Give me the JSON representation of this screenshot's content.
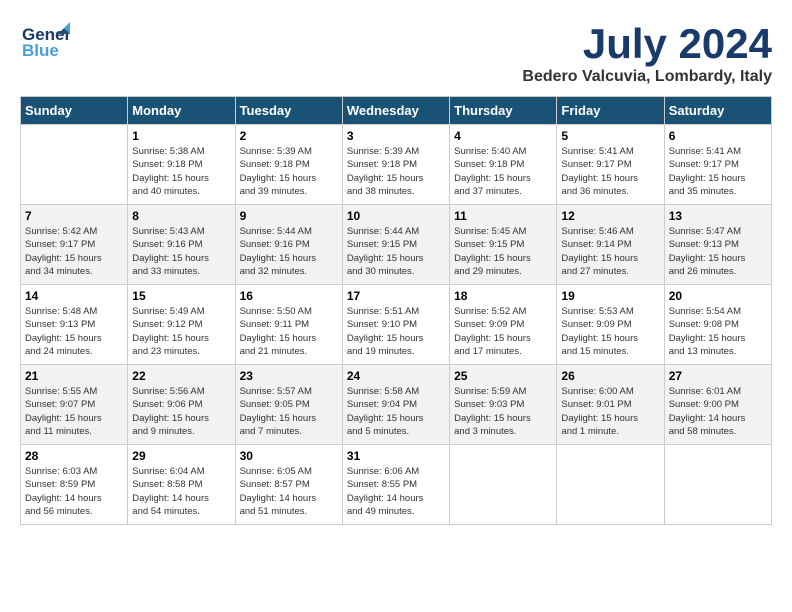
{
  "header": {
    "logo_line1": "General",
    "logo_line2": "Blue",
    "month": "July 2024",
    "location": "Bedero Valcuvia, Lombardy, Italy"
  },
  "weekdays": [
    "Sunday",
    "Monday",
    "Tuesday",
    "Wednesday",
    "Thursday",
    "Friday",
    "Saturday"
  ],
  "weeks": [
    [
      {
        "day": "",
        "info": ""
      },
      {
        "day": "1",
        "info": "Sunrise: 5:38 AM\nSunset: 9:18 PM\nDaylight: 15 hours\nand 40 minutes."
      },
      {
        "day": "2",
        "info": "Sunrise: 5:39 AM\nSunset: 9:18 PM\nDaylight: 15 hours\nand 39 minutes."
      },
      {
        "day": "3",
        "info": "Sunrise: 5:39 AM\nSunset: 9:18 PM\nDaylight: 15 hours\nand 38 minutes."
      },
      {
        "day": "4",
        "info": "Sunrise: 5:40 AM\nSunset: 9:18 PM\nDaylight: 15 hours\nand 37 minutes."
      },
      {
        "day": "5",
        "info": "Sunrise: 5:41 AM\nSunset: 9:17 PM\nDaylight: 15 hours\nand 36 minutes."
      },
      {
        "day": "6",
        "info": "Sunrise: 5:41 AM\nSunset: 9:17 PM\nDaylight: 15 hours\nand 35 minutes."
      }
    ],
    [
      {
        "day": "7",
        "info": "Sunrise: 5:42 AM\nSunset: 9:17 PM\nDaylight: 15 hours\nand 34 minutes."
      },
      {
        "day": "8",
        "info": "Sunrise: 5:43 AM\nSunset: 9:16 PM\nDaylight: 15 hours\nand 33 minutes."
      },
      {
        "day": "9",
        "info": "Sunrise: 5:44 AM\nSunset: 9:16 PM\nDaylight: 15 hours\nand 32 minutes."
      },
      {
        "day": "10",
        "info": "Sunrise: 5:44 AM\nSunset: 9:15 PM\nDaylight: 15 hours\nand 30 minutes."
      },
      {
        "day": "11",
        "info": "Sunrise: 5:45 AM\nSunset: 9:15 PM\nDaylight: 15 hours\nand 29 minutes."
      },
      {
        "day": "12",
        "info": "Sunrise: 5:46 AM\nSunset: 9:14 PM\nDaylight: 15 hours\nand 27 minutes."
      },
      {
        "day": "13",
        "info": "Sunrise: 5:47 AM\nSunset: 9:13 PM\nDaylight: 15 hours\nand 26 minutes."
      }
    ],
    [
      {
        "day": "14",
        "info": "Sunrise: 5:48 AM\nSunset: 9:13 PM\nDaylight: 15 hours\nand 24 minutes."
      },
      {
        "day": "15",
        "info": "Sunrise: 5:49 AM\nSunset: 9:12 PM\nDaylight: 15 hours\nand 23 minutes."
      },
      {
        "day": "16",
        "info": "Sunrise: 5:50 AM\nSunset: 9:11 PM\nDaylight: 15 hours\nand 21 minutes."
      },
      {
        "day": "17",
        "info": "Sunrise: 5:51 AM\nSunset: 9:10 PM\nDaylight: 15 hours\nand 19 minutes."
      },
      {
        "day": "18",
        "info": "Sunrise: 5:52 AM\nSunset: 9:09 PM\nDaylight: 15 hours\nand 17 minutes."
      },
      {
        "day": "19",
        "info": "Sunrise: 5:53 AM\nSunset: 9:09 PM\nDaylight: 15 hours\nand 15 minutes."
      },
      {
        "day": "20",
        "info": "Sunrise: 5:54 AM\nSunset: 9:08 PM\nDaylight: 15 hours\nand 13 minutes."
      }
    ],
    [
      {
        "day": "21",
        "info": "Sunrise: 5:55 AM\nSunset: 9:07 PM\nDaylight: 15 hours\nand 11 minutes."
      },
      {
        "day": "22",
        "info": "Sunrise: 5:56 AM\nSunset: 9:06 PM\nDaylight: 15 hours\nand 9 minutes."
      },
      {
        "day": "23",
        "info": "Sunrise: 5:57 AM\nSunset: 9:05 PM\nDaylight: 15 hours\nand 7 minutes."
      },
      {
        "day": "24",
        "info": "Sunrise: 5:58 AM\nSunset: 9:04 PM\nDaylight: 15 hours\nand 5 minutes."
      },
      {
        "day": "25",
        "info": "Sunrise: 5:59 AM\nSunset: 9:03 PM\nDaylight: 15 hours\nand 3 minutes."
      },
      {
        "day": "26",
        "info": "Sunrise: 6:00 AM\nSunset: 9:01 PM\nDaylight: 15 hours\nand 1 minute."
      },
      {
        "day": "27",
        "info": "Sunrise: 6:01 AM\nSunset: 9:00 PM\nDaylight: 14 hours\nand 58 minutes."
      }
    ],
    [
      {
        "day": "28",
        "info": "Sunrise: 6:03 AM\nSunset: 8:59 PM\nDaylight: 14 hours\nand 56 minutes."
      },
      {
        "day": "29",
        "info": "Sunrise: 6:04 AM\nSunset: 8:58 PM\nDaylight: 14 hours\nand 54 minutes."
      },
      {
        "day": "30",
        "info": "Sunrise: 6:05 AM\nSunset: 8:57 PM\nDaylight: 14 hours\nand 51 minutes."
      },
      {
        "day": "31",
        "info": "Sunrise: 6:06 AM\nSunset: 8:55 PM\nDaylight: 14 hours\nand 49 minutes."
      },
      {
        "day": "",
        "info": ""
      },
      {
        "day": "",
        "info": ""
      },
      {
        "day": "",
        "info": ""
      }
    ]
  ]
}
